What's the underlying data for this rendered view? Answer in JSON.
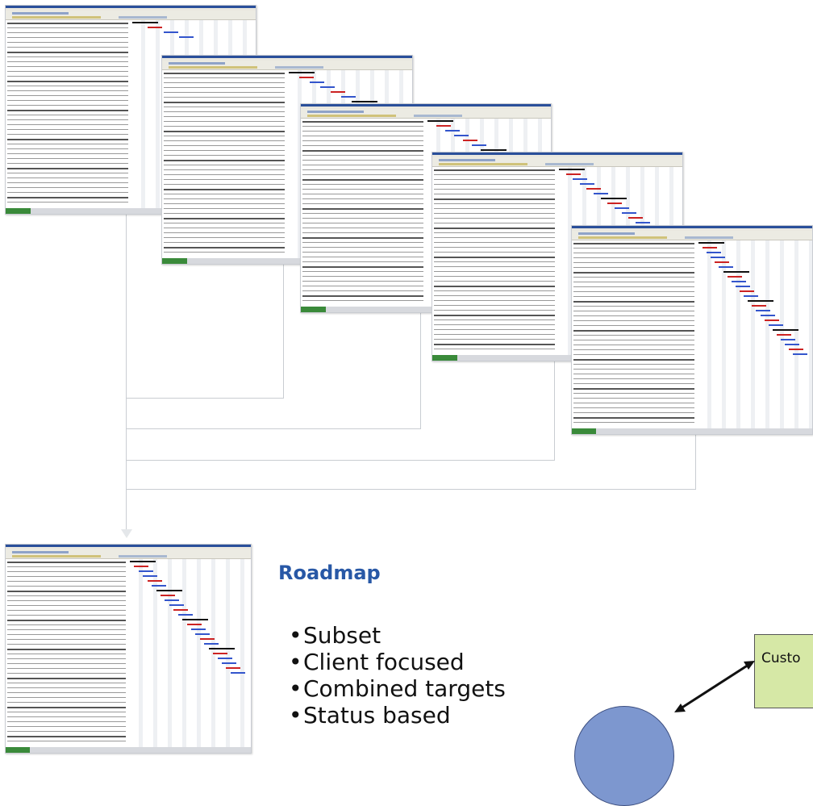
{
  "slide": {
    "title": "Roadmap",
    "bullets": [
      "Subset",
      "Client focused",
      "Combined targets",
      "Status based"
    ]
  },
  "diagram": {
    "target_box_label": "Custo",
    "colors": {
      "title": "#2858a6",
      "box_fill": "#d6e8a6",
      "circle_fill": "#7d97cf",
      "connector": "#c9cdd2",
      "gantt_bar_blue": "#3355cc",
      "gantt_bar_red": "#cc2222",
      "summary_bar": "#111111"
    },
    "thumbnails": [
      {
        "name": "project-plan-1"
      },
      {
        "name": "project-plan-2"
      },
      {
        "name": "project-plan-3"
      },
      {
        "name": "project-plan-4"
      },
      {
        "name": "project-plan-5"
      },
      {
        "name": "roadmap-combined"
      }
    ]
  }
}
